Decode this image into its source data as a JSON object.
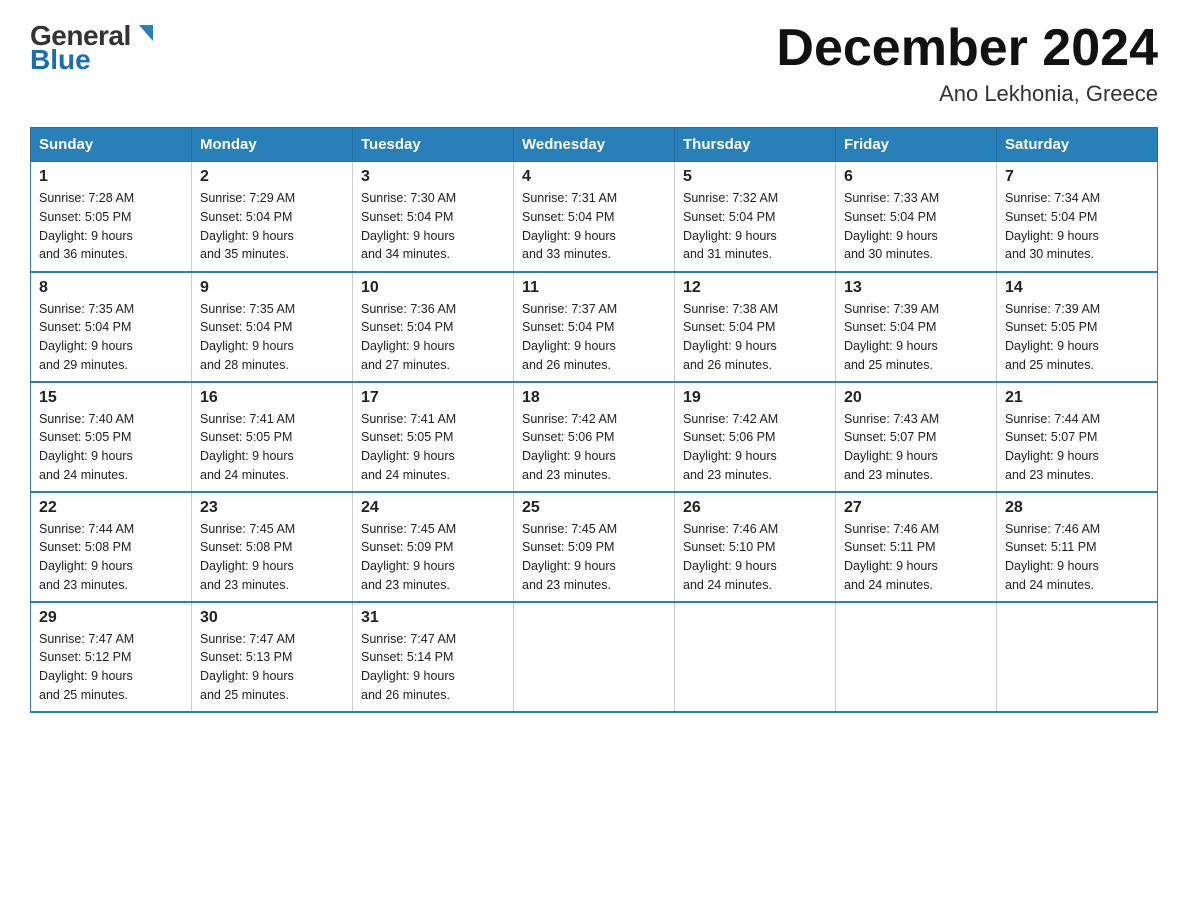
{
  "header": {
    "logo_general": "General",
    "logo_blue": "Blue",
    "month_title": "December 2024",
    "location": "Ano Lekhonia, Greece"
  },
  "days_of_week": [
    "Sunday",
    "Monday",
    "Tuesday",
    "Wednesday",
    "Thursday",
    "Friday",
    "Saturday"
  ],
  "weeks": [
    [
      {
        "day": "1",
        "info": "Sunrise: 7:28 AM\nSunset: 5:05 PM\nDaylight: 9 hours\nand 36 minutes."
      },
      {
        "day": "2",
        "info": "Sunrise: 7:29 AM\nSunset: 5:04 PM\nDaylight: 9 hours\nand 35 minutes."
      },
      {
        "day": "3",
        "info": "Sunrise: 7:30 AM\nSunset: 5:04 PM\nDaylight: 9 hours\nand 34 minutes."
      },
      {
        "day": "4",
        "info": "Sunrise: 7:31 AM\nSunset: 5:04 PM\nDaylight: 9 hours\nand 33 minutes."
      },
      {
        "day": "5",
        "info": "Sunrise: 7:32 AM\nSunset: 5:04 PM\nDaylight: 9 hours\nand 31 minutes."
      },
      {
        "day": "6",
        "info": "Sunrise: 7:33 AM\nSunset: 5:04 PM\nDaylight: 9 hours\nand 30 minutes."
      },
      {
        "day": "7",
        "info": "Sunrise: 7:34 AM\nSunset: 5:04 PM\nDaylight: 9 hours\nand 30 minutes."
      }
    ],
    [
      {
        "day": "8",
        "info": "Sunrise: 7:35 AM\nSunset: 5:04 PM\nDaylight: 9 hours\nand 29 minutes."
      },
      {
        "day": "9",
        "info": "Sunrise: 7:35 AM\nSunset: 5:04 PM\nDaylight: 9 hours\nand 28 minutes."
      },
      {
        "day": "10",
        "info": "Sunrise: 7:36 AM\nSunset: 5:04 PM\nDaylight: 9 hours\nand 27 minutes."
      },
      {
        "day": "11",
        "info": "Sunrise: 7:37 AM\nSunset: 5:04 PM\nDaylight: 9 hours\nand 26 minutes."
      },
      {
        "day": "12",
        "info": "Sunrise: 7:38 AM\nSunset: 5:04 PM\nDaylight: 9 hours\nand 26 minutes."
      },
      {
        "day": "13",
        "info": "Sunrise: 7:39 AM\nSunset: 5:04 PM\nDaylight: 9 hours\nand 25 minutes."
      },
      {
        "day": "14",
        "info": "Sunrise: 7:39 AM\nSunset: 5:05 PM\nDaylight: 9 hours\nand 25 minutes."
      }
    ],
    [
      {
        "day": "15",
        "info": "Sunrise: 7:40 AM\nSunset: 5:05 PM\nDaylight: 9 hours\nand 24 minutes."
      },
      {
        "day": "16",
        "info": "Sunrise: 7:41 AM\nSunset: 5:05 PM\nDaylight: 9 hours\nand 24 minutes."
      },
      {
        "day": "17",
        "info": "Sunrise: 7:41 AM\nSunset: 5:05 PM\nDaylight: 9 hours\nand 24 minutes."
      },
      {
        "day": "18",
        "info": "Sunrise: 7:42 AM\nSunset: 5:06 PM\nDaylight: 9 hours\nand 23 minutes."
      },
      {
        "day": "19",
        "info": "Sunrise: 7:42 AM\nSunset: 5:06 PM\nDaylight: 9 hours\nand 23 minutes."
      },
      {
        "day": "20",
        "info": "Sunrise: 7:43 AM\nSunset: 5:07 PM\nDaylight: 9 hours\nand 23 minutes."
      },
      {
        "day": "21",
        "info": "Sunrise: 7:44 AM\nSunset: 5:07 PM\nDaylight: 9 hours\nand 23 minutes."
      }
    ],
    [
      {
        "day": "22",
        "info": "Sunrise: 7:44 AM\nSunset: 5:08 PM\nDaylight: 9 hours\nand 23 minutes."
      },
      {
        "day": "23",
        "info": "Sunrise: 7:45 AM\nSunset: 5:08 PM\nDaylight: 9 hours\nand 23 minutes."
      },
      {
        "day": "24",
        "info": "Sunrise: 7:45 AM\nSunset: 5:09 PM\nDaylight: 9 hours\nand 23 minutes."
      },
      {
        "day": "25",
        "info": "Sunrise: 7:45 AM\nSunset: 5:09 PM\nDaylight: 9 hours\nand 23 minutes."
      },
      {
        "day": "26",
        "info": "Sunrise: 7:46 AM\nSunset: 5:10 PM\nDaylight: 9 hours\nand 24 minutes."
      },
      {
        "day": "27",
        "info": "Sunrise: 7:46 AM\nSunset: 5:11 PM\nDaylight: 9 hours\nand 24 minutes."
      },
      {
        "day": "28",
        "info": "Sunrise: 7:46 AM\nSunset: 5:11 PM\nDaylight: 9 hours\nand 24 minutes."
      }
    ],
    [
      {
        "day": "29",
        "info": "Sunrise: 7:47 AM\nSunset: 5:12 PM\nDaylight: 9 hours\nand 25 minutes."
      },
      {
        "day": "30",
        "info": "Sunrise: 7:47 AM\nSunset: 5:13 PM\nDaylight: 9 hours\nand 25 minutes."
      },
      {
        "day": "31",
        "info": "Sunrise: 7:47 AM\nSunset: 5:14 PM\nDaylight: 9 hours\nand 26 minutes."
      },
      {
        "day": "",
        "info": ""
      },
      {
        "day": "",
        "info": ""
      },
      {
        "day": "",
        "info": ""
      },
      {
        "day": "",
        "info": ""
      }
    ]
  ]
}
